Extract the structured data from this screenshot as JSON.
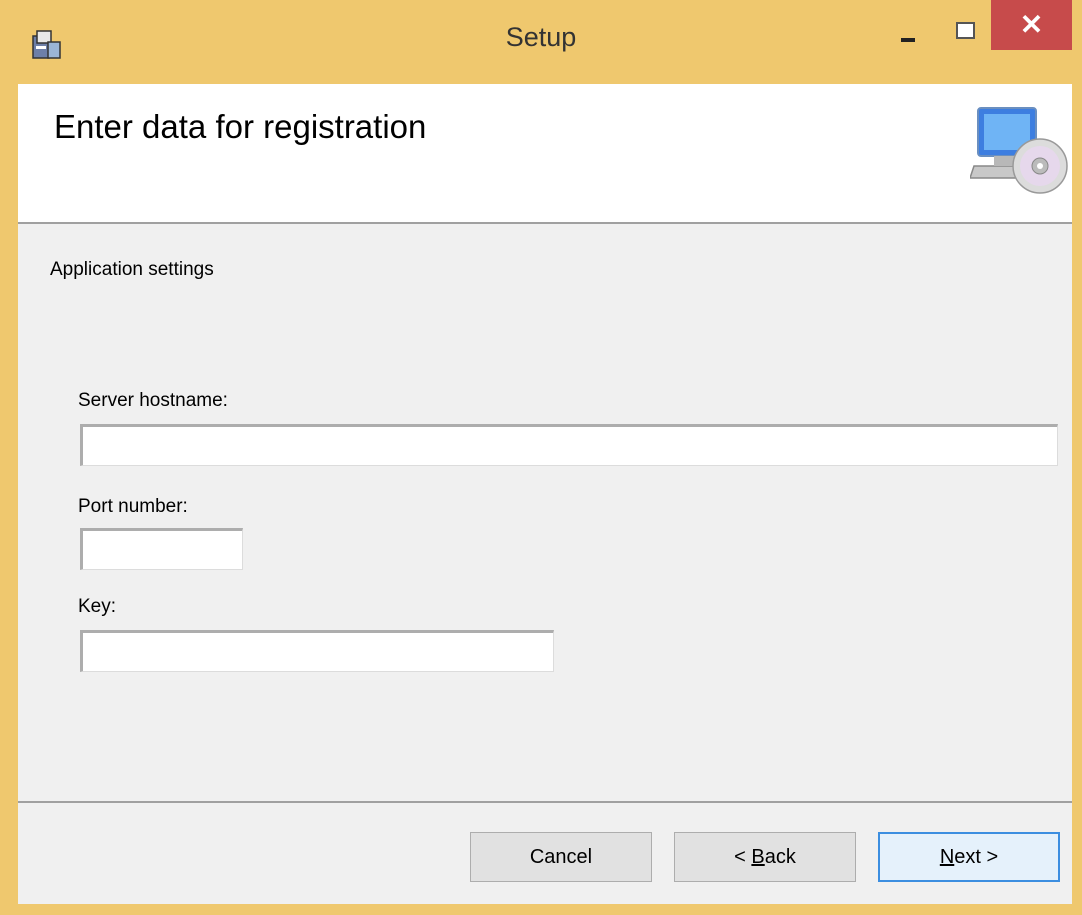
{
  "window": {
    "title": "Setup"
  },
  "banner": {
    "title": "Enter data for registration"
  },
  "section": {
    "label": "Application settings"
  },
  "fields": {
    "server_hostname": {
      "label": "Server hostname:",
      "value": ""
    },
    "port_number": {
      "label": "Port number:",
      "value": ""
    },
    "key": {
      "label": "Key:",
      "value": ""
    }
  },
  "buttons": {
    "cancel": "Cancel",
    "back_prefix": "< ",
    "back_accel": "B",
    "back_rest": "ack",
    "next_accel": "N",
    "next_rest": "ext >"
  },
  "icons": {
    "app": "setup-package-icon",
    "banner": "computer-cd-icon",
    "minimize": "minimize-icon",
    "maximize": "maximize-icon",
    "close": "close-icon"
  },
  "colors": {
    "titlebar": "#efc86e",
    "close": "#c74b4b",
    "client": "#f0f0f0"
  }
}
